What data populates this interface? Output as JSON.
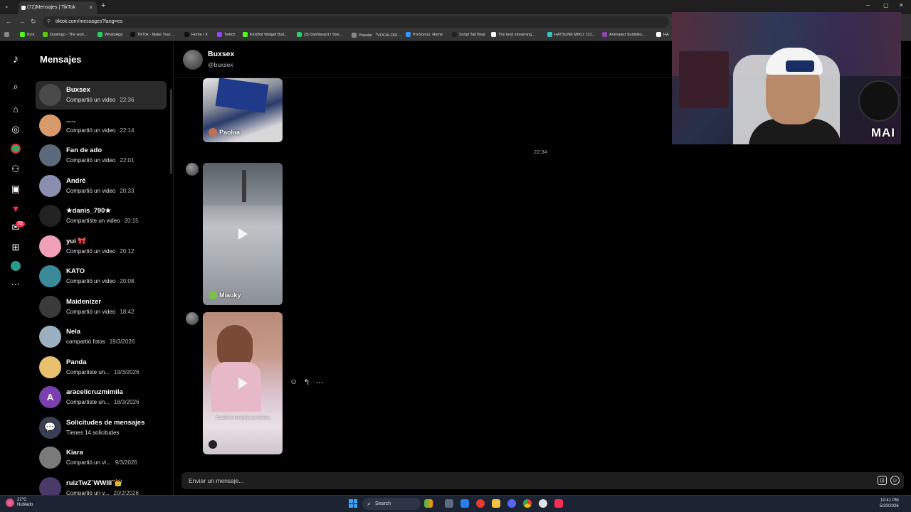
{
  "browser": {
    "tab_title": "(72)Mensajes | TikTok",
    "tab_close": "×",
    "new_tab": "+",
    "url": "tiktok.com/messages?lang=es",
    "bookmarks": [
      {
        "label": "Kick",
        "color": "#53fc18"
      },
      {
        "label": "Duolingo - The worl...",
        "color": "#58cc02"
      },
      {
        "label": "WhatsApp",
        "color": "#25d366"
      },
      {
        "label": "TikTok - Make Your...",
        "color": "#111111"
      },
      {
        "label": "Home / X",
        "color": "#111111"
      },
      {
        "label": "Twitch",
        "color": "#9146ff"
      },
      {
        "label": "KickBot Widget Buil...",
        "color": "#53fc18"
      },
      {
        "label": "(3) Dashboard / Stre...",
        "color": "#2ecc71"
      },
      {
        "label": "Popular 「VOCALOID...",
        "color": "#888888"
      },
      {
        "label": "PreSonus: Home",
        "color": "#3399ff"
      },
      {
        "label": "Script Tail Beat",
        "color": "#222222"
      },
      {
        "label": "The best streaming...",
        "color": "#ffffff"
      },
      {
        "label": "HATSUNE MIKU: CO...",
        "color": "#39c5bb"
      },
      {
        "label": "Animated Subtitles...",
        "color": "#8e44ad"
      },
      {
        "label": "HA",
        "color": "#ffffff"
      }
    ]
  },
  "sidebar_icons": [
    "tiktok-logo-icon",
    "search-icon",
    "home-icon",
    "explore-icon",
    "following-icon",
    "friends-icon",
    "live-icon",
    "activity-icon",
    "messages-icon",
    "upload-icon",
    "profile-icon",
    "more-icon"
  ],
  "messages_badge": "72",
  "conversations": {
    "title": "Mensajes",
    "items": [
      {
        "name": "Buxsex",
        "preview": "Compartió un video",
        "time": "22:36",
        "avatar": "#4a4a4a"
      },
      {
        "name": ".....",
        "preview": "Compartió un video",
        "time": "22:14",
        "avatar": "#d89a6a"
      },
      {
        "name": "Fan de ado",
        "preview": "Compartió un video",
        "time": "22:01",
        "avatar": "#5a6a7a"
      },
      {
        "name": "André",
        "preview": "Compartió un video",
        "time": "20:33",
        "avatar": "#8a8fb0"
      },
      {
        "name": "★danis_790★",
        "preview": "Compartiste un video",
        "time": "20:15",
        "avatar": "#222222"
      },
      {
        "name": "yui 🎀",
        "preview": "Compartió un video",
        "time": "20:12",
        "avatar": "#f2a0b8"
      },
      {
        "name": "KATO",
        "preview": "Compartió un video",
        "time": "20:08",
        "avatar": "#3a8a9a"
      },
      {
        "name": "Maidenizer",
        "preview": "Compartió un video",
        "time": "18:42",
        "avatar": "#3a3a3a"
      },
      {
        "name": "Nela",
        "preview": "compartió fotos",
        "time": "19/3/2026",
        "avatar": "#9ab0c0"
      },
      {
        "name": "Panda",
        "preview": "Compartiste un...",
        "time": "19/3/2026",
        "avatar": "#e8c070"
      },
      {
        "name": "aracelicruzmimila",
        "preview": "Compartiste un...",
        "time": "18/3/2026",
        "avatar": "#7b3fb0",
        "initial": "A"
      },
      {
        "name": "Solicitudes de mensajes",
        "preview": "Tienes 14 solicitudes",
        "time": "",
        "avatar": "#3a3f55",
        "initial": "💬"
      },
      {
        "name": "Kiara",
        "preview": "Compartió un vi...",
        "time": "9/3/2026",
        "avatar": "#7a7a7a"
      },
      {
        "name": "ruizTwZ`WWIII`👑",
        "preview": "Compartió un v...",
        "time": "20/2/2026",
        "avatar": "#4a3a6a"
      }
    ]
  },
  "chat": {
    "name": "Buxsex",
    "handle": "@buxsex",
    "timestamp": "22:34",
    "videos": [
      {
        "owner": "Paolaa",
        "owner_color": "#c07050"
      },
      {
        "owner": "Miauky",
        "owner_color": "#7ac04a"
      },
      {
        "owner": "",
        "owner_color": "#222222",
        "caption": "Cuando no me ayuda con la tarea"
      }
    ],
    "input_placeholder": "Enviar un mensaje..."
  },
  "webcam": {
    "brand": "MAI"
  },
  "taskbar": {
    "weather_temp": "22°C",
    "weather_desc": "Nublado",
    "search_label": "Search",
    "time": "10:41 PM",
    "date": "5/20/2026"
  }
}
